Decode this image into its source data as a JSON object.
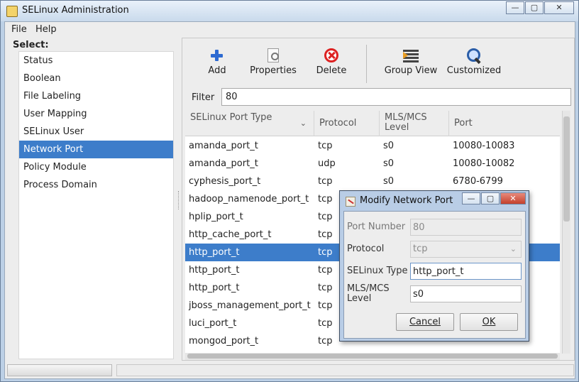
{
  "window": {
    "title": "SELinux Administration",
    "minimize_glyph": "—",
    "maximize_glyph": "▢",
    "close_glyph": "✕"
  },
  "menu": [
    "File",
    "Help"
  ],
  "nav": {
    "label": "Select:",
    "items": [
      "Status",
      "Boolean",
      "File Labeling",
      "User Mapping",
      "SELinux User",
      "Network Port",
      "Policy Module",
      "Process Domain"
    ],
    "selected": "Network Port"
  },
  "toolbar": {
    "add": "Add",
    "properties": "Properties",
    "delete": "Delete",
    "group_view": "Group View",
    "customized": "Customized"
  },
  "filter": {
    "label": "Filter",
    "value": "80"
  },
  "table": {
    "columns": [
      "SELinux Port Type",
      "Protocol",
      "MLS/MCS Level",
      "Port"
    ],
    "sort_glyph": "⌄",
    "rows": [
      [
        "amanda_port_t",
        "tcp",
        "s0",
        "10080-10083"
      ],
      [
        "amanda_port_t",
        "udp",
        "s0",
        "10080-10082"
      ],
      [
        "cyphesis_port_t",
        "tcp",
        "s0",
        "6780-6799"
      ],
      [
        "hadoop_namenode_port_t",
        "tcp",
        "",
        ""
      ],
      [
        "hplip_port_t",
        "tcp",
        "",
        ""
      ],
      [
        "http_cache_port_t",
        "tcp",
        "",
        ""
      ],
      [
        "http_port_t",
        "tcp",
        "",
        ""
      ],
      [
        "http_port_t",
        "tcp",
        "",
        ""
      ],
      [
        "http_port_t",
        "tcp",
        "",
        ""
      ],
      [
        "jboss_management_port_t",
        "tcp",
        "",
        ""
      ],
      [
        "luci_port_t",
        "tcp",
        "",
        ""
      ],
      [
        "mongod_port_t",
        "tcp",
        "",
        ""
      ]
    ],
    "selected_row": 6
  },
  "dialog": {
    "title": "Modify Network Port",
    "port_number_label": "Port Number",
    "port_number_value": "80",
    "protocol_label": "Protocol",
    "protocol_value": "tcp",
    "selinux_type_label": "SELinux Type",
    "selinux_type_value": "http_port_t",
    "mls_label": "MLS/MCS Level",
    "mls_value": "s0",
    "cancel": "Cancel",
    "ok": "OK",
    "minimize_glyph": "—",
    "maximize_glyph": "▢",
    "close_glyph": "✕"
  }
}
